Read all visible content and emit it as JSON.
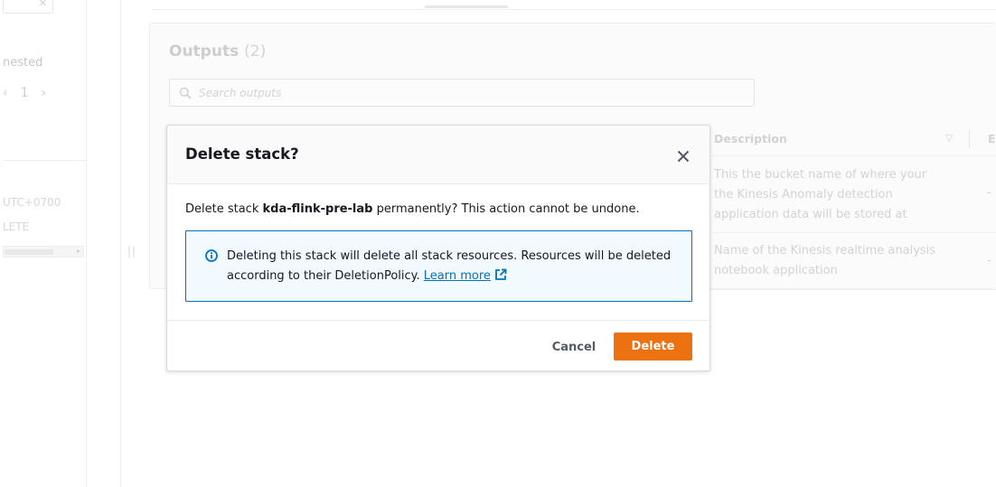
{
  "background": {
    "left_panel": {
      "close_glyph": "✕",
      "nested_text": "nested",
      "pager": {
        "prev": "‹",
        "page": "1",
        "next": "›"
      },
      "timestamp": "UTC+0700",
      "status": "LETE",
      "drag_handle": "||"
    },
    "outputs": {
      "title": "Outputs",
      "count": "(2)",
      "search_placeholder": "Search outputs",
      "columns": [
        {
          "label": "Description"
        }
      ],
      "sort_glyph": "▽",
      "next_column_initial": "E",
      "rows": [
        {
          "description": "This the bucket name of where your the Kinesis Anomaly detection application data will be stored at",
          "extra": "-"
        },
        {
          "description": "Name of the Kinesis realtime analysis notebook application",
          "extra": "-"
        }
      ]
    }
  },
  "modal": {
    "title": "Delete stack?",
    "body_prefix": "Delete stack ",
    "stack_name": "kda-flink-pre-lab",
    "body_suffix": " permanently? This action cannot be undone.",
    "alert_text": "Deleting this stack will delete all stack resources. Resources will be deleted according to their DeletionPolicy.",
    "learn_more": "Learn more",
    "cancel_label": "Cancel",
    "delete_label": "Delete"
  },
  "colors": {
    "primary_orange": "#ec7211",
    "link_blue": "#0073bb",
    "info_bg": "#f1faff",
    "text_dark": "#16191f"
  }
}
